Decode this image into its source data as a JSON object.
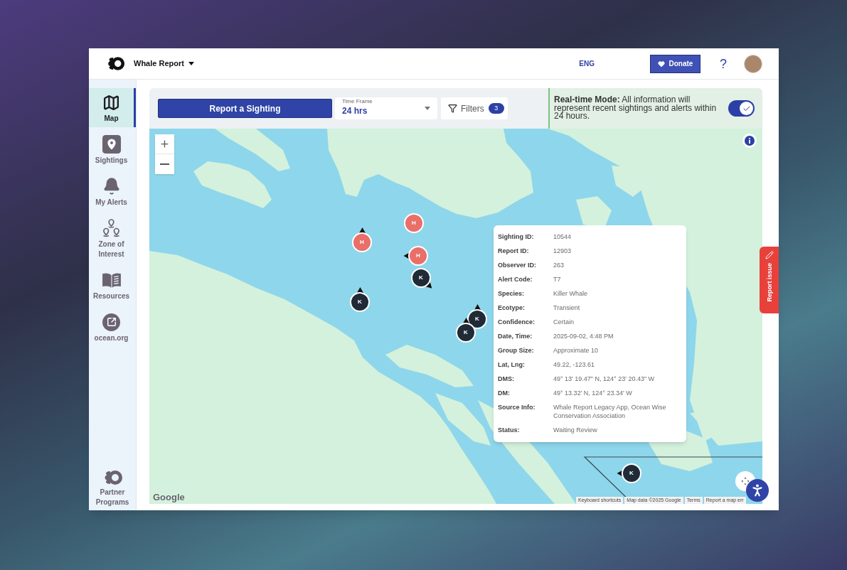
{
  "header": {
    "app_name": "Whale Report",
    "language": "ENG",
    "donate": "Donate",
    "help": "?"
  },
  "sidebar": {
    "items": [
      {
        "label": "Map",
        "selected": true
      },
      {
        "label": "Sightings",
        "selected": false
      },
      {
        "label": "My Alerts",
        "selected": false
      },
      {
        "label": "Zone of Interest",
        "selected": false
      },
      {
        "label": "Resources",
        "selected": false
      },
      {
        "label": "ocean.org",
        "selected": false
      }
    ],
    "footer_item": {
      "label": "Partner Programs"
    }
  },
  "toolbar": {
    "report_button": "Report a Sighting",
    "time_frame": {
      "label": "Time Frame",
      "value": "24 hrs"
    },
    "filters": {
      "label": "Filters",
      "count": "3"
    },
    "realtime": {
      "text": "**Real-time Mode:** All information will represent recent sightings and alerts within 24 hours.",
      "on": true
    }
  },
  "map": {
    "markers": [
      {
        "label": "H",
        "color": "#ea6f69",
        "kind": "plain"
      },
      {
        "label": "H",
        "color": "#ea6f69",
        "kind": "north"
      },
      {
        "label": "H",
        "color": "#ea6f69",
        "kind": "west"
      },
      {
        "label": "K",
        "color": "#212b37",
        "kind": "southeast"
      },
      {
        "label": "K",
        "color": "#212b37",
        "kind": "north"
      },
      {
        "label": "K",
        "color": "#212b37",
        "kind": "north"
      },
      {
        "label": "K",
        "color": "#212b37",
        "kind": "north"
      },
      {
        "label": "K",
        "color": "#212b37",
        "kind": "west"
      }
    ],
    "popup": {
      "rows": [
        {
          "label": "Sighting ID:",
          "value": "10544"
        },
        {
          "label": "Report ID:",
          "value": "12903"
        },
        {
          "label": "Observer ID:",
          "value": "263"
        },
        {
          "label": "Alert Code:",
          "value": "T7"
        },
        {
          "label": "Species:",
          "value": "Killer Whale"
        },
        {
          "label": "Ecotype:",
          "value": "Transient"
        },
        {
          "label": "Confidence:",
          "value": "Certain"
        },
        {
          "label": "Date, Time:",
          "value": "2025-09-02, 4:48 PM"
        },
        {
          "label": "Group Size:",
          "value": "Approximate 10"
        },
        {
          "label": "Lat, Lng:",
          "value": "49.22, -123.61"
        },
        {
          "label": "DMS:",
          "value": "49° 13' 19.47\" N, 124° 23' 20.43\" W"
        },
        {
          "label": "DM:",
          "value": "49° 13.32' N, 124° 23.34' W"
        },
        {
          "label": "Source Info:",
          "value": "Whale Report Legacy App, Ocean Wise Conservation Association"
        },
        {
          "label": "Status:",
          "value": "Waiting Review"
        }
      ]
    },
    "logo": "Google",
    "attribution": [
      "Keyboard shortcuts",
      "Map data ©2025 Google",
      "Terms",
      "Report a map err"
    ]
  },
  "report_issue": "Report issue"
}
